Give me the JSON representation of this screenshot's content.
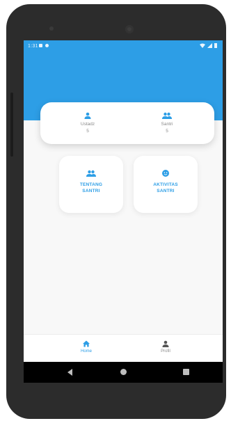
{
  "status_bar": {
    "time": "1:31",
    "left_icons": [
      "notification-icon",
      "notification-icon"
    ],
    "right_icons": [
      "wifi-icon",
      "signal-icon",
      "battery-icon"
    ]
  },
  "stats": [
    {
      "label": "Ustadz",
      "value": "5",
      "icon": "person-icon"
    },
    {
      "label": "Santri",
      "value": "5",
      "icon": "people-icon"
    }
  ],
  "menu": [
    {
      "label": "TENTANG\nSANTRI",
      "icon": "people-icon"
    },
    {
      "label": "AKTIVITAS\nSANTRI",
      "icon": "face-icon"
    }
  ],
  "bottom_nav": [
    {
      "label": "Home",
      "icon": "home-icon",
      "active": true
    },
    {
      "label": "Profil",
      "icon": "person-icon",
      "active": false
    }
  ],
  "colors": {
    "primary": "#2d9ee6",
    "background": "#f8f8f8",
    "muted_text": "#8a8a8a"
  }
}
